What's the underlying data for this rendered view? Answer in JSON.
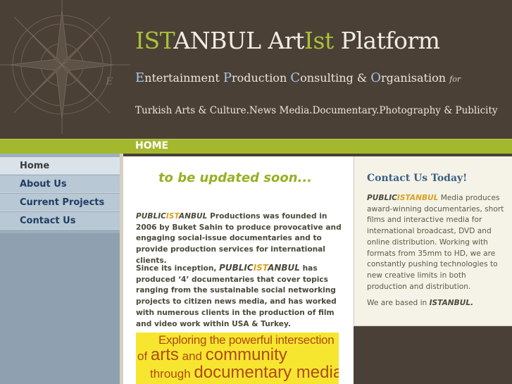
{
  "header": {
    "title_parts": [
      "IST",
      "ANBUL Art",
      "Ist",
      " Platform"
    ],
    "subtitle_parts": [
      "E",
      "ntertainment ",
      "P",
      "roduction ",
      "C",
      "onsulting & ",
      "O",
      "rganisation ",
      "for"
    ],
    "tagline": "Turkish Arts & Culture.News Media.Documentary.Photography & Publicity"
  },
  "page_label": "HOME",
  "nav": {
    "items": [
      {
        "label": "Home"
      },
      {
        "label": "About Us"
      },
      {
        "label": "Current Projects"
      },
      {
        "label": "Contact Us"
      }
    ]
  },
  "main": {
    "notice": "to be updated soon...",
    "para1": {
      "brand_a": "PUBLIC",
      "brand_b": "IST",
      "brand_c": "ANBUL",
      "text": " Productions was founded in 2006 by Buket Sahin to produce provocative and engaging social-issue documentaries and to provide production services for international clients."
    },
    "para2": {
      "pre": "Since its inception, ",
      "brand_a": "PUBLIC",
      "brand_b": "IST",
      "brand_c": "ANBUL",
      "text": "  has produced ‘4’ documentaries that cover topics ranging from the sustainable social networking projects to citizen news media, and has worked with numerous clients in the production of film and video work within USA & Turkey."
    },
    "banner": {
      "line1": "Exploring the powerful intersection",
      "line2_a": "of ",
      "line2_b": "arts",
      "line2_c": " and ",
      "line2_d": "community",
      "line3_a": "through ",
      "line3_b": "documentary media."
    }
  },
  "contact": {
    "heading": "Contact Us Today!",
    "brand_a": "PUBLIC",
    "brand_b": "ISTANBUL",
    "body": " Media produces award-winning documentaries, short films and interactive media for international broadcast, DVD and online distribution. Working with formats from 35mm to HD, we are constantly pushing technologies to new creative limits in both production and distribution.",
    "based_pre": "We are based in ",
    "based_city": "ISTANBUL."
  },
  "colors": {
    "header_bg": "#4b4036",
    "accent_green": "#a3b82c",
    "sidebar_blue": "#9dafbd",
    "brand_orange": "#d9a022",
    "link_blue": "#1f3e63"
  }
}
